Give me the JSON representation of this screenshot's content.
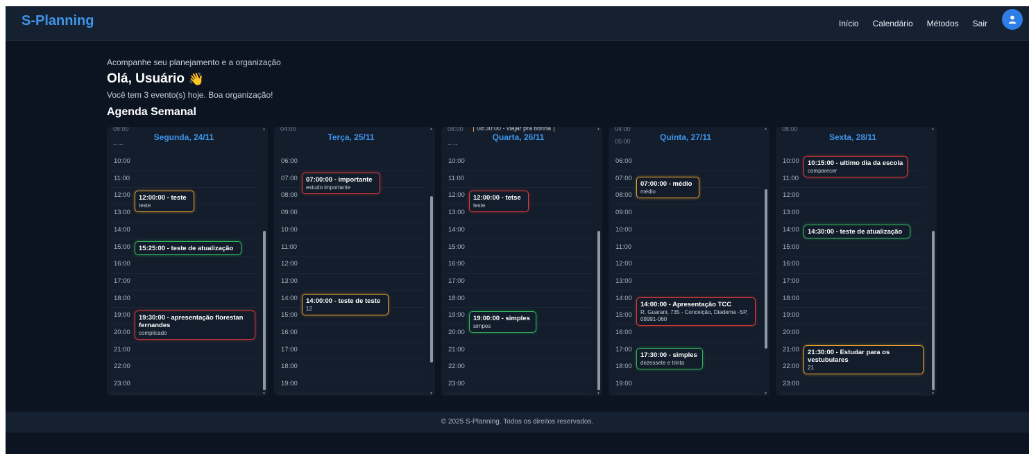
{
  "app": {
    "brand": "S-Planning"
  },
  "nav": {
    "links": [
      "Início",
      "Calendário",
      "Métodos",
      "Sair"
    ],
    "avatar_icon": "user-icon"
  },
  "intro": {
    "subtitle": "Acompanhe seu planejamento e a organização",
    "greeting": "Olá, Usuário",
    "wave": "👋",
    "events_note": "Você tem 3 evento(s) hoje. Boa organização!",
    "agenda_title": "Agenda Semanal"
  },
  "days": [
    {
      "header": "Segunda, 24/11",
      "partial_top": "08:00",
      "partial_dashes": "-- --",
      "slots": [
        "10:00",
        "11:00",
        "12:00",
        "13:00",
        "14:00",
        "15:00",
        "16:00",
        "17:00",
        "18:00",
        "19:00",
        "20:00",
        "21:00",
        "22:00",
        "23:00"
      ],
      "events": [
        {
          "title": "12:00:00 - teste",
          "desc": "teste",
          "color": "orange"
        },
        {
          "title": "15:25:00 - teste de atualização",
          "desc": "",
          "color": "green"
        },
        {
          "title": "19:30:00 - apresentação florestan fernandes",
          "desc": "complicado",
          "color": "red"
        }
      ]
    },
    {
      "header": "Terça, 25/11",
      "partial_top": "04:00",
      "slots": [
        "06:00",
        "07:00",
        "08:00",
        "09:00",
        "10:00",
        "11:00",
        "12:00",
        "13:00",
        "14:00",
        "15:00",
        "16:00",
        "17:00",
        "18:00",
        "19:00"
      ],
      "events": [
        {
          "title": "07:00:00 - importante",
          "desc": "estudo importante",
          "color": "red"
        },
        {
          "title": "14:00:00 - teste de teste",
          "desc": "12",
          "color": "orange"
        }
      ]
    },
    {
      "header": "Quarta, 26/11",
      "partial_top": "08:00",
      "partial_event": "08:30:00 - viajar pra florina",
      "partial_dashes": "-- --",
      "slots": [
        "10:00",
        "11:00",
        "12:00",
        "13:00",
        "14:00",
        "15:00",
        "16:00",
        "17:00",
        "18:00",
        "19:00",
        "20:00",
        "21:00",
        "22:00",
        "23:00"
      ],
      "events": [
        {
          "title": "12:00:00 - tetse",
          "desc": "teste",
          "color": "red"
        },
        {
          "title": "19:00:00 - simples",
          "desc": "simpes",
          "color": "green"
        }
      ]
    },
    {
      "header": "Quinta, 27/11",
      "partial_top": "04:00",
      "partial_second": "05:00",
      "slots": [
        "06:00",
        "07:00",
        "08:00",
        "09:00",
        "10:00",
        "11:00",
        "12:00",
        "13:00",
        "14:00",
        "15:00",
        "16:00",
        "17:00",
        "18:00",
        "19:00"
      ],
      "events": [
        {
          "title": "07:00:00 - médio",
          "desc": "médio",
          "color": "orange"
        },
        {
          "title": "14:00:00 - Apresentação TCC",
          "desc": "R. Guarani, 735 - Conceição, Diadema -SP, 09991-060",
          "color": "red"
        },
        {
          "title": "17:30:00 - simples",
          "desc": "dezessete e trinta",
          "color": "green"
        }
      ]
    },
    {
      "header": "Sexta, 28/11",
      "partial_top": "08:00",
      "slots": [
        "10:00",
        "11:00",
        "12:00",
        "13:00",
        "14:00",
        "15:00",
        "16:00",
        "17:00",
        "18:00",
        "19:00",
        "20:00",
        "21:00",
        "22:00",
        "23:00"
      ],
      "events": [
        {
          "title": "10:15:00 - ultimo dia da escola",
          "desc": "comparecer",
          "color": "red"
        },
        {
          "title": "14:30:00 - teste de atualização",
          "desc": "",
          "color": "green"
        },
        {
          "title": "21:30:00 - Estudar para os vestubulares",
          "desc": "21",
          "color": "orange"
        }
      ]
    }
  ],
  "footer": {
    "text": "© 2025 S-Planning. Todos os direitos reservados."
  }
}
